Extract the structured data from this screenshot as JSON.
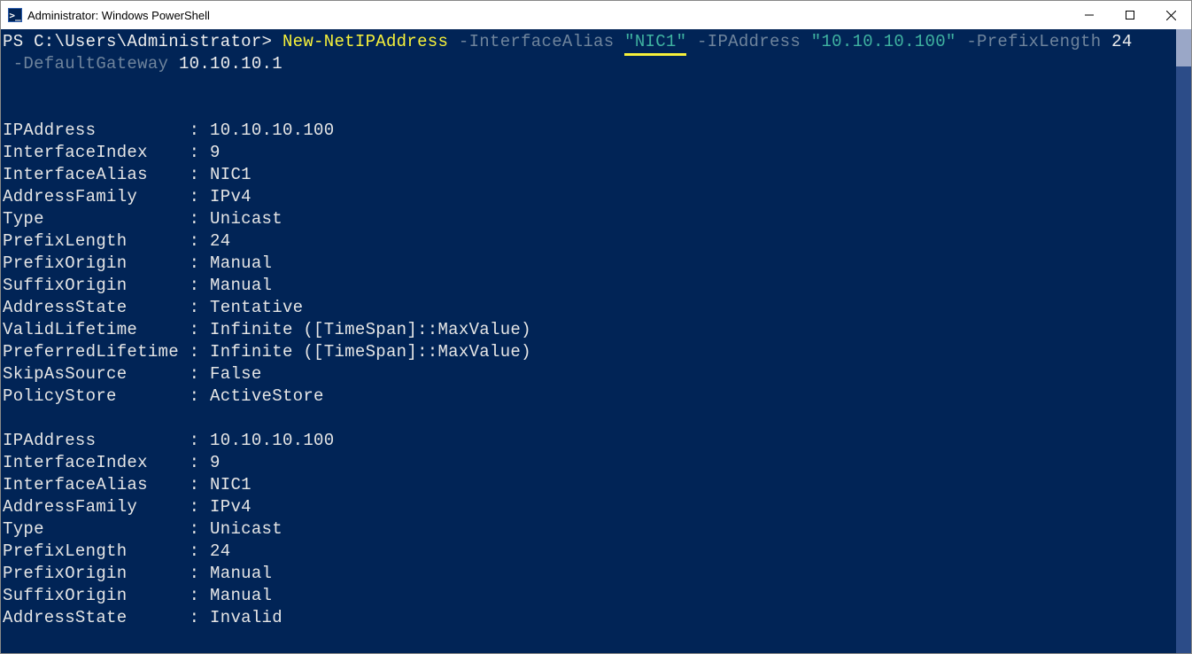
{
  "window": {
    "title": "Administrator: Windows PowerShell",
    "icon_text": ">_"
  },
  "prompt": "PS C:\\Users\\Administrator>",
  "command": {
    "cmdlet": "New-NetIPAddress",
    "p1_name": "-InterfaceAlias",
    "p1_val": "\"NIC1\"",
    "p2_name": "-IPAddress",
    "p2_val": "\"10.10.10.100\"",
    "p3_name": "-PrefixLength",
    "p3_val": "24",
    "p4_name": "-DefaultGateway",
    "p4_val": "10.10.10.1"
  },
  "blocks": [
    [
      {
        "k": "IPAddress",
        "v": "10.10.10.100"
      },
      {
        "k": "InterfaceIndex",
        "v": "9"
      },
      {
        "k": "InterfaceAlias",
        "v": "NIC1"
      },
      {
        "k": "AddressFamily",
        "v": "IPv4"
      },
      {
        "k": "Type",
        "v": "Unicast"
      },
      {
        "k": "PrefixLength",
        "v": "24"
      },
      {
        "k": "PrefixOrigin",
        "v": "Manual"
      },
      {
        "k": "SuffixOrigin",
        "v": "Manual"
      },
      {
        "k": "AddressState",
        "v": "Tentative"
      },
      {
        "k": "ValidLifetime",
        "v": "Infinite ([TimeSpan]::MaxValue)"
      },
      {
        "k": "PreferredLifetime",
        "v": "Infinite ([TimeSpan]::MaxValue)"
      },
      {
        "k": "SkipAsSource",
        "v": "False"
      },
      {
        "k": "PolicyStore",
        "v": "ActiveStore"
      }
    ],
    [
      {
        "k": "IPAddress",
        "v": "10.10.10.100"
      },
      {
        "k": "InterfaceIndex",
        "v": "9"
      },
      {
        "k": "InterfaceAlias",
        "v": "NIC1"
      },
      {
        "k": "AddressFamily",
        "v": "IPv4"
      },
      {
        "k": "Type",
        "v": "Unicast"
      },
      {
        "k": "PrefixLength",
        "v": "24"
      },
      {
        "k": "PrefixOrigin",
        "v": "Manual"
      },
      {
        "k": "SuffixOrigin",
        "v": "Manual"
      },
      {
        "k": "AddressState",
        "v": "Invalid"
      }
    ]
  ]
}
